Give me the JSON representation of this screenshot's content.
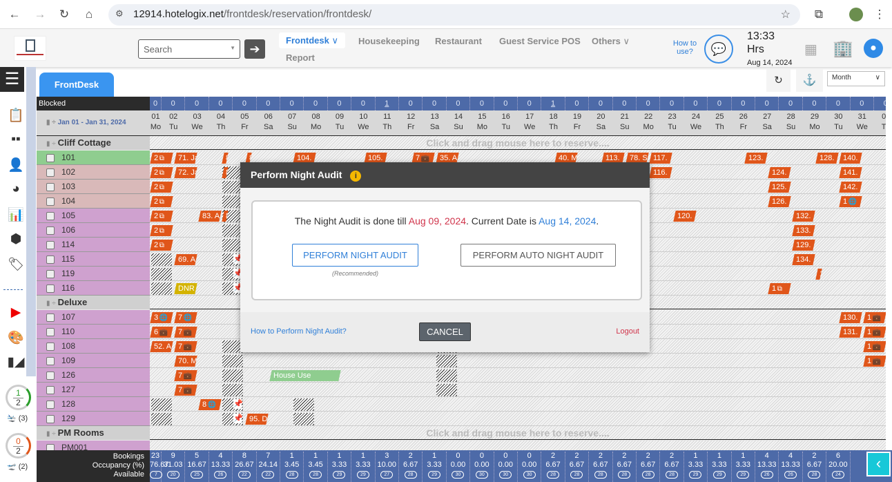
{
  "browser": {
    "url_domain": "12914.hotelogix.net",
    "url_path": "/frontdesk/reservation/frontdesk/"
  },
  "header": {
    "search_placeholder": "Search",
    "nav": [
      {
        "label": "Frontdesk",
        "active": true,
        "dropdown": true
      },
      {
        "label": "Housekeeping"
      },
      {
        "label": "Restaurant"
      },
      {
        "label": "Guest Service POS"
      },
      {
        "label": "Others",
        "dropdown": true
      },
      {
        "label": "Report"
      }
    ],
    "how_to_use": "How to use?",
    "time": "13:33",
    "time_unit": "Hrs",
    "date": "Aug 14, 2024"
  },
  "tab": "FrontDesk",
  "toolbar": {
    "view_select": "Month"
  },
  "grid": {
    "blocked_label": "Blocked",
    "range_label": "Jan 01 - Jan 31, 2024",
    "blocked": [
      "0",
      "0",
      "0",
      "0",
      "0",
      "0",
      "0",
      "0",
      "0",
      "0",
      "1",
      "0",
      "0",
      "0",
      "0",
      "0",
      "0",
      "1",
      "0",
      "0",
      "0",
      "0",
      "0",
      "0",
      "0",
      "0",
      "0",
      "0",
      "0",
      "0",
      "0",
      "0"
    ],
    "days": [
      [
        "01",
        "Mo"
      ],
      [
        "02",
        "Tu"
      ],
      [
        "03",
        "We"
      ],
      [
        "04",
        "Th"
      ],
      [
        "05",
        "Fr"
      ],
      [
        "06",
        "Sa"
      ],
      [
        "07",
        "Su"
      ],
      [
        "08",
        "Mo"
      ],
      [
        "09",
        "Tu"
      ],
      [
        "10",
        "We"
      ],
      [
        "11",
        "Th"
      ],
      [
        "12",
        "Fr"
      ],
      [
        "13",
        "Sa"
      ],
      [
        "14",
        "Su"
      ],
      [
        "15",
        "Mo"
      ],
      [
        "16",
        "Tu"
      ],
      [
        "17",
        "We"
      ],
      [
        "18",
        "Th"
      ],
      [
        "19",
        "Fr"
      ],
      [
        "20",
        "Sa"
      ],
      [
        "21",
        "Su"
      ],
      [
        "22",
        "Mo"
      ],
      [
        "23",
        "Tu"
      ],
      [
        "24",
        "We"
      ],
      [
        "25",
        "Th"
      ],
      [
        "26",
        "Fr"
      ],
      [
        "27",
        "Sa"
      ],
      [
        "28",
        "Su"
      ],
      [
        "29",
        "Mo"
      ],
      [
        "30",
        "Tu"
      ],
      [
        "31",
        "We"
      ],
      [
        "01",
        "Th"
      ]
    ],
    "reserve_hint": "Click and drag mouse here to reserve....",
    "groups": [
      {
        "name": "Cliff Cottage",
        "rooms": [
          {
            "no": "101",
            "color": "#8fcd8f"
          },
          {
            "no": "102",
            "color": "#d9b9b9"
          },
          {
            "no": "103",
            "color": "#d9b9b9"
          },
          {
            "no": "104",
            "color": "#d9b9b9"
          },
          {
            "no": "105",
            "color": "#cfa1cf"
          },
          {
            "no": "106",
            "color": "#cfa1cf"
          },
          {
            "no": "114",
            "color": "#cfa1cf"
          },
          {
            "no": "115",
            "color": "#cfa1cf"
          },
          {
            "no": "119",
            "color": "#cfa1cf"
          },
          {
            "no": "116",
            "color": "#cfa1cf"
          }
        ]
      },
      {
        "name": "Deluxe",
        "rooms": [
          {
            "no": "107",
            "color": "#cfa1cf"
          },
          {
            "no": "110",
            "color": "#cfa1cf"
          },
          {
            "no": "108",
            "color": "#cfa1cf"
          },
          {
            "no": "109",
            "color": "#cfa1cf"
          },
          {
            "no": "126",
            "color": "#cfa1cf"
          },
          {
            "no": "127",
            "color": "#cfa1cf"
          },
          {
            "no": "128",
            "color": "#cfa1cf"
          },
          {
            "no": "129",
            "color": "#cfa1cf"
          }
        ]
      },
      {
        "name": "PM Rooms",
        "rooms": [
          {
            "no": "PM001",
            "color": "#cfa1cf"
          }
        ]
      }
    ],
    "bookings": [
      {
        "room": "101",
        "day": 1,
        "label": "2",
        "icon": "copy"
      },
      {
        "room": "101",
        "day": 2,
        "label": "71. Ja"
      },
      {
        "room": "101",
        "day": 4,
        "kind": "sliver",
        "label": "8"
      },
      {
        "room": "101",
        "day": 5,
        "kind": "sliver",
        "label": "8"
      },
      {
        "room": "101",
        "day": 7,
        "label": "104."
      },
      {
        "room": "101",
        "day": 10,
        "label": "105."
      },
      {
        "room": "101",
        "day": 12,
        "label": "7",
        "icon": "suitcase"
      },
      {
        "room": "101",
        "day": 13,
        "label": "35. A"
      },
      {
        "room": "101",
        "day": 18,
        "label": "40. M"
      },
      {
        "room": "101",
        "day": 20,
        "label": "113."
      },
      {
        "room": "101",
        "day": 21,
        "label": "78. S"
      },
      {
        "room": "101",
        "day": 22,
        "label": "117."
      },
      {
        "room": "101",
        "day": 26,
        "label": "123."
      },
      {
        "room": "101",
        "day": 29,
        "label": "128."
      },
      {
        "room": "101",
        "day": 30,
        "label": "140."
      },
      {
        "room": "102",
        "day": 1,
        "label": "2",
        "icon": "copy"
      },
      {
        "room": "102",
        "day": 2,
        "label": "72. Ja"
      },
      {
        "room": "102",
        "day": 4,
        "kind": "sliver",
        "label": "8"
      },
      {
        "room": "102",
        "day": 22,
        "label": "116."
      },
      {
        "room": "102",
        "day": 27,
        "label": "124."
      },
      {
        "room": "102",
        "day": 30,
        "label": "141."
      },
      {
        "room": "103",
        "day": 1,
        "label": "2",
        "icon": "copy"
      },
      {
        "room": "103",
        "day": 27,
        "label": "125."
      },
      {
        "room": "103",
        "day": 30,
        "label": "142."
      },
      {
        "room": "104",
        "day": 1,
        "label": "2",
        "icon": "copy"
      },
      {
        "room": "104",
        "day": 27,
        "label": "126."
      },
      {
        "room": "104",
        "day": 30,
        "label": "1",
        "icon": "globe"
      },
      {
        "room": "105",
        "day": 1,
        "label": "2",
        "icon": "copy"
      },
      {
        "room": "105",
        "day": 3,
        "label": "83. A"
      },
      {
        "room": "105",
        "day": 4,
        "kind": "sliver",
        "label": "8"
      },
      {
        "room": "105",
        "day": 23,
        "label": "120."
      },
      {
        "room": "105",
        "day": 28,
        "label": "132."
      },
      {
        "room": "106",
        "day": 1,
        "label": "2",
        "icon": "copy"
      },
      {
        "room": "106",
        "day": 28,
        "label": "133."
      },
      {
        "room": "114",
        "day": 1,
        "label": "2",
        "icon": "copy"
      },
      {
        "room": "114",
        "day": 28,
        "label": "129."
      },
      {
        "room": "115",
        "day": 2,
        "label": "69. A"
      },
      {
        "room": "115",
        "day": 28,
        "label": "134."
      },
      {
        "room": "119",
        "day": 29,
        "kind": "sliver",
        "label": "1"
      },
      {
        "room": "116",
        "day": 2,
        "label": "DNR",
        "kind": "dnr"
      },
      {
        "room": "116",
        "day": 27,
        "label": "1",
        "icon": "copy"
      },
      {
        "room": "107",
        "day": 1,
        "label": "3",
        "icon": "globe"
      },
      {
        "room": "107",
        "day": 2,
        "label": "7",
        "icon": "globe"
      },
      {
        "room": "107",
        "day": 30,
        "label": "130."
      },
      {
        "room": "107",
        "day": 31,
        "label": "1",
        "icon": "suitcase"
      },
      {
        "room": "110",
        "day": 1,
        "label": "6",
        "icon": "suitcase"
      },
      {
        "room": "110",
        "day": 2,
        "label": "7",
        "icon": "suitcase"
      },
      {
        "room": "110",
        "day": 30,
        "label": "131."
      },
      {
        "room": "110",
        "day": 31,
        "label": "1",
        "icon": "suitcase"
      },
      {
        "room": "108",
        "day": 1,
        "label": "52. A"
      },
      {
        "room": "108",
        "day": 2,
        "label": "7",
        "icon": "suitcase"
      },
      {
        "room": "108",
        "day": 31,
        "label": "1",
        "icon": "suitcase"
      },
      {
        "room": "109",
        "day": 2,
        "label": "70. M"
      },
      {
        "room": "109",
        "day": 31,
        "label": "1",
        "icon": "suitcase"
      },
      {
        "room": "126",
        "day": 2,
        "label": "7",
        "icon": "suitcase"
      },
      {
        "room": "126",
        "day": 6,
        "nights": 3,
        "label": "House Use",
        "kind": "house-use"
      },
      {
        "room": "127",
        "day": 2,
        "label": "7",
        "icon": "suitcase"
      },
      {
        "room": "128",
        "day": 3,
        "label": "8",
        "icon": "globe"
      },
      {
        "room": "129",
        "day": 5,
        "label": "95. D"
      }
    ],
    "blocked_cells": [
      {
        "room": "102",
        "day": 4
      },
      {
        "room": "103",
        "day": 4
      },
      {
        "room": "104",
        "day": 4
      },
      {
        "room": "105",
        "day": 4
      },
      {
        "room": "106",
        "day": 4
      },
      {
        "room": "114",
        "day": 4
      },
      {
        "room": "115",
        "day": 4,
        "pin": true
      },
      {
        "room": "119",
        "day": 4,
        "pin": true
      },
      {
        "room": "116",
        "day": 4,
        "pin": true
      },
      {
        "room": "115",
        "day": 1
      },
      {
        "room": "119",
        "day": 1
      },
      {
        "room": "116",
        "day": 1
      },
      {
        "room": "108",
        "day": 4
      },
      {
        "room": "109",
        "day": 4
      },
      {
        "room": "126",
        "day": 4
      },
      {
        "room": "127",
        "day": 4
      },
      {
        "room": "128",
        "day": 4,
        "pin": true
      },
      {
        "room": "129",
        "day": 4,
        "pin": true
      },
      {
        "room": "128",
        "day": 1
      },
      {
        "room": "129",
        "day": 1
      },
      {
        "room": "128",
        "day": 7
      },
      {
        "room": "129",
        "day": 7
      },
      {
        "room": "108",
        "day": 13
      },
      {
        "room": "109",
        "day": 13
      },
      {
        "room": "126",
        "day": 13
      },
      {
        "room": "127",
        "day": 13
      }
    ]
  },
  "footer": {
    "labels": [
      "Bookings",
      "Occupancy (%)",
      "Available"
    ],
    "bookings": [
      "23",
      "9",
      "5",
      "4",
      "8",
      "7",
      "1",
      "1",
      "1",
      "1",
      "3",
      "2",
      "1",
      "0",
      "0",
      "0",
      "0",
      "2",
      "2",
      "2",
      "2",
      "2",
      "2",
      "1",
      "1",
      "1",
      "4",
      "4",
      "2",
      "6"
    ],
    "occupancy": [
      "76.67",
      "31.03",
      "16.67",
      "13.33",
      "26.67",
      "24.14",
      "3.45",
      "3.45",
      "3.33",
      "3.33",
      "10.00",
      "6.67",
      "3.33",
      "0.00",
      "0.00",
      "0.00",
      "0.00",
      "6.67",
      "6.67",
      "6.67",
      "6.67",
      "6.67",
      "6.67",
      "3.33",
      "3.33",
      "3.33",
      "13.33",
      "13.33",
      "6.67",
      "20.00"
    ],
    "available": [
      "7",
      "20",
      "25",
      "26",
      "22",
      "22",
      "28",
      "28",
      "29",
      "29",
      "27",
      "28",
      "29",
      "30",
      "30",
      "30",
      "30",
      "28",
      "28",
      "28",
      "28",
      "28",
      "28",
      "29",
      "29",
      "29",
      "26",
      "26",
      "28",
      "24"
    ]
  },
  "side_stats": [
    {
      "num": "1",
      "den": "2",
      "color": "#2a9d2a",
      "count": "(3)"
    },
    {
      "num": "0",
      "den": "2",
      "color": "#e0561a",
      "count": "(2)"
    }
  ],
  "modal": {
    "title": "Perform Night Audit",
    "msg_prefix": "The Night Audit is done till ",
    "audit_date": "Aug 09, 2024",
    "msg_mid": ". Current Date is ",
    "current_date": "Aug 14, 2024",
    "msg_end": ".",
    "perform": "PERFORM NIGHT AUDIT",
    "recommended": "(Recommended)",
    "auto": "PERFORM AUTO NIGHT AUDIT",
    "help_link": "How to Perform Night Audit?",
    "cancel": "CANCEL",
    "logout": "Logout"
  },
  "colors": {
    "accent": "#2f7fd8",
    "booking": "#e0561a",
    "grid_header": "#4d6aa8",
    "audit_date": "#d0334a",
    "footer_btn": "#17c8d8"
  }
}
